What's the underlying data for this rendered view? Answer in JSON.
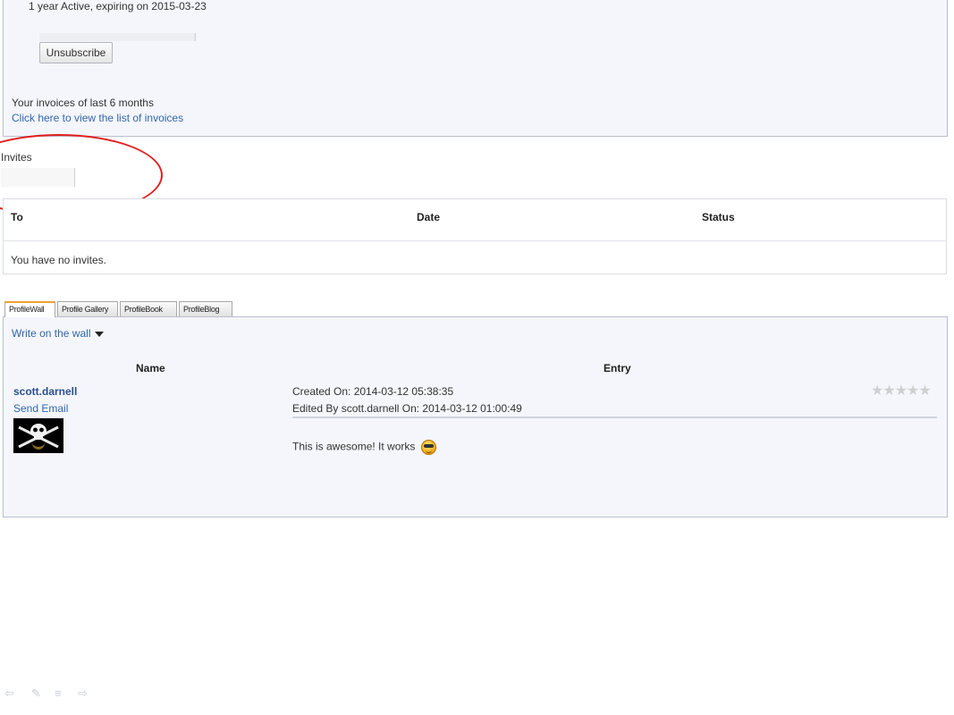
{
  "subscription": {
    "status_text": "1 year Active, expiring on 2015-03-23",
    "unsubscribe_label": "Unsubscribe",
    "invoices_label": "Your invoices of last 6 months",
    "invoices_link": "Click here to view the list of invoices"
  },
  "invites": {
    "title": "Invites",
    "columns": [
      "To",
      "Date",
      "Status"
    ],
    "empty_message": "You have no invites."
  },
  "profile": {
    "tabs": [
      {
        "label": "ProfileWall",
        "active": true
      },
      {
        "label": "Profile Gallery",
        "active": false
      },
      {
        "label": "ProfileBook",
        "active": false
      },
      {
        "label": "ProfileBlog",
        "active": false
      }
    ],
    "write_link": "Write on the wall",
    "col_name": "Name",
    "col_entry": "Entry",
    "post": {
      "author": "scott.darnell",
      "send_email": "Send Email",
      "created": "Created On: 2014-03-12 05:38:35",
      "edited": "Edited By scott.darnell On: 2014-03-12 01:00:49",
      "text": "This is awesome! It works",
      "emoticon": "cool-smiley-icon",
      "rating_stars": 5,
      "rating_filled": 0
    }
  },
  "colors": {
    "panel_bg": "#f4f6fb",
    "link": "#3366aa",
    "author": "#2a4f8f",
    "highlight_circle": "#e02020",
    "active_tab_accent": "#f0a030"
  }
}
